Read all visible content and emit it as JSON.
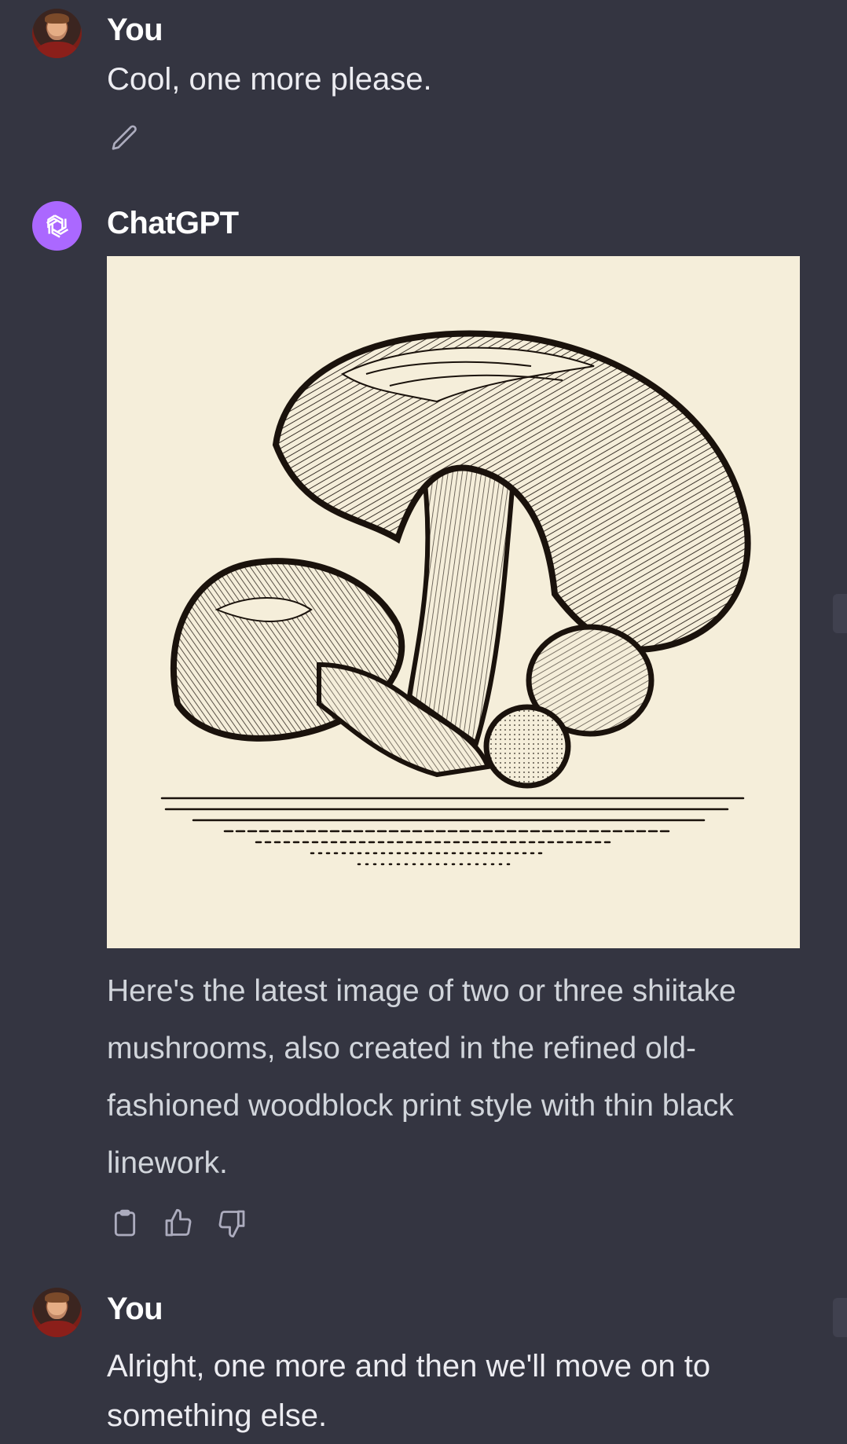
{
  "conversation": {
    "messages": [
      {
        "author": "You",
        "text": "Cool, one more please.",
        "actions": [
          "edit-icon"
        ]
      },
      {
        "author": "ChatGPT",
        "image": {
          "subject": "woodblock print of shiitake mushrooms",
          "background_color": "#f5eeda",
          "ink_color": "#1a120c"
        },
        "text": "Here's the latest image of two or three shiitake mushrooms, also created in the refined old-fashioned woodblock print style with thin black linework.",
        "actions": [
          "clipboard-icon",
          "thumbs-up-icon",
          "thumbs-down-icon"
        ]
      },
      {
        "author": "You",
        "text": "Alright, one more and then we'll move on to something else."
      }
    ]
  },
  "colors": {
    "background": "#343541",
    "assistant_avatar": "#ab68ff",
    "text": "#ececf1",
    "muted_text": "#d1d5db",
    "icon": "#acacbe"
  }
}
